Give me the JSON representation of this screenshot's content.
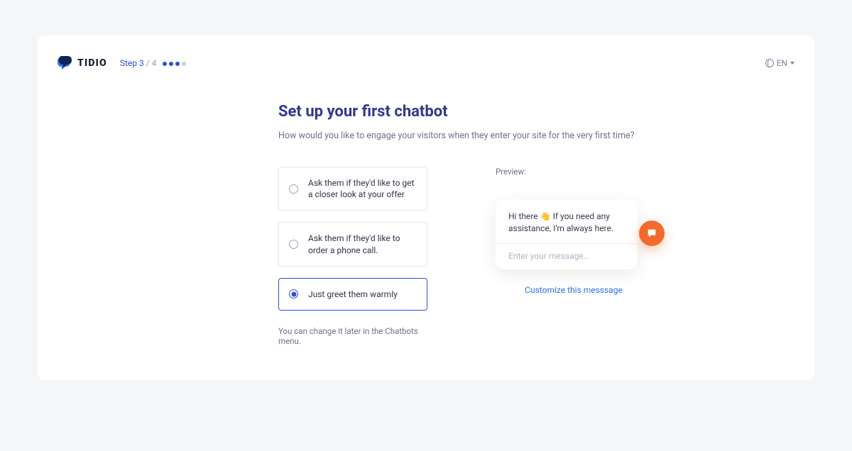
{
  "header": {
    "brand": "TIDIO",
    "step_label": "Step 3",
    "step_total": "/ 4",
    "language": "EN"
  },
  "main": {
    "title": "Set up your first chatbot",
    "subtitle": "How would you like to engage your visitors when they enter your site for the very first time?",
    "options": [
      {
        "label": "Ask them if they'd like to get a closer look at your offer"
      },
      {
        "label": "Ask them if they'd like to order a phone call."
      },
      {
        "label": "Just greet them warmly"
      }
    ],
    "footnote": "You can change it later in the Chatbots menu."
  },
  "preview": {
    "label": "Preview:",
    "message": "Hi there 👋 If you need any assistance, I'm always here.",
    "placeholder": "Enter your message...",
    "customize_label": "Customize this messsage"
  }
}
